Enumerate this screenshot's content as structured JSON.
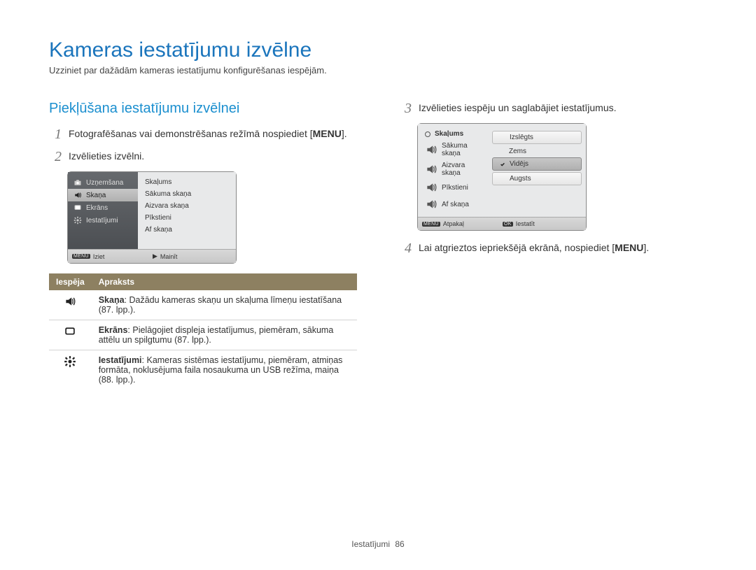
{
  "title": "Kameras iestatījumu izvēlne",
  "subtitle": "Uzziniet par dažādām kameras iestatījumu konfigurēšanas iespējām.",
  "left": {
    "heading": "Piekļūšana iestatījumu izvēlnei",
    "step1_num": "1",
    "step1_a": "Fotografēšanas vai demonstrēšanas režīmā nospiediet [",
    "step1_btn": "MENU",
    "step1_b": "].",
    "step2_num": "2",
    "step2": "Izvēlieties izvēlni.",
    "cam1": {
      "left": [
        "Uzņemšana",
        "Skaņa",
        "Ekrāns",
        "Iestatījumi"
      ],
      "right": [
        "Skaļums",
        "Sākuma skaņa",
        "Aizvara skaņa",
        "Pīkstieni",
        "Af skaņa"
      ],
      "foot_left_label": "MENU",
      "foot_left_text": "Iziet",
      "foot_right_sym": "▶",
      "foot_right_text": "Mainīt"
    },
    "table": {
      "h1": "Iespēja",
      "h2": "Apraksts",
      "rows": [
        {
          "icon": "sound",
          "b": "Skaņa",
          "text": ": Dažādu kameras skaņu un skaļuma līmeņu iestatīšana (87. lpp.)."
        },
        {
          "icon": "display",
          "b": "Ekrāns",
          "text": ": Pielāgojiet displeja iestatījumus, piemēram, sākuma attēlu un spilgtumu (87. lpp.)."
        },
        {
          "icon": "gear",
          "b": "Iestatījumi",
          "text": ": Kameras sistēmas iestatījumu, piemēram, atmiņas formāta, noklusējuma faila nosaukuma un USB režīma, maiņa (88. lpp.)."
        }
      ]
    }
  },
  "right": {
    "step3_num": "3",
    "step3": "Izvēlieties iespēju un saglabājiet iestatījumus.",
    "cam2": {
      "left_header": "Skaļums",
      "left": [
        "Sākuma skaņa",
        "Aizvara skaņa",
        "Pīkstieni",
        "Af skaņa"
      ],
      "right": [
        "Izslēgts",
        "Zems",
        "Vidējs",
        "Augsts"
      ],
      "foot_left_label": "MENU",
      "foot_left_text": "Atpakaļ",
      "foot_right_label": "OK",
      "foot_right_text": "Iestatīt"
    },
    "step4_num": "4",
    "step4_a": "Lai atgrieztos iepriekšējā ekrānā, nospiediet [",
    "step4_btn": "MENU",
    "step4_b": "]."
  },
  "footer": {
    "section": "Iestatījumi",
    "page": "86"
  }
}
